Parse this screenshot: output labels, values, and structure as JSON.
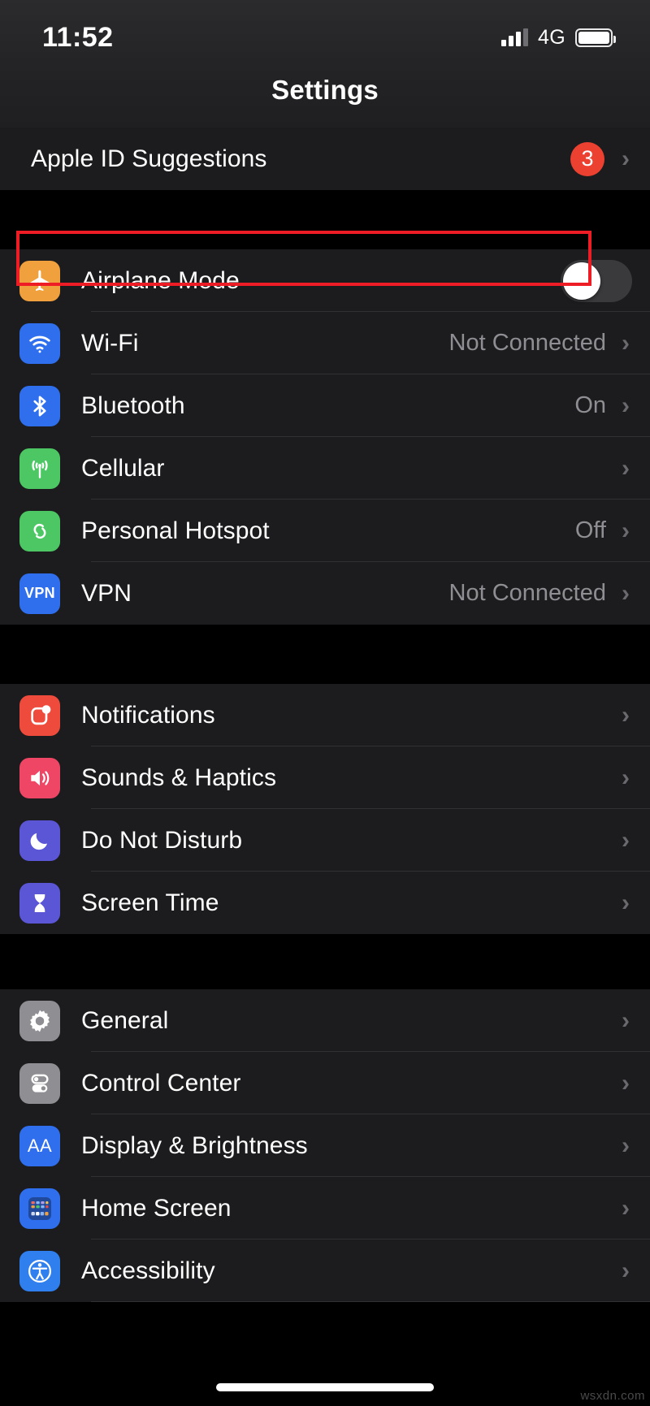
{
  "status_bar": {
    "time": "11:52",
    "network_type": "4G",
    "signal_icon": "signal-bars-icon",
    "battery_icon": "battery-icon"
  },
  "nav": {
    "title": "Settings"
  },
  "sections": [
    {
      "name": "suggestions",
      "rows": [
        {
          "label": "Apple ID Suggestions",
          "badge": "3",
          "chevron": "›",
          "icon": null,
          "type": "plain"
        }
      ]
    },
    {
      "name": "connectivity",
      "rows": [
        {
          "label": "Airplane Mode",
          "icon": "airplane-icon",
          "icon_color": "#F0A03C",
          "type": "toggle",
          "toggle_on": false,
          "highlighted": true
        },
        {
          "label": "Wi-Fi",
          "icon": "wifi-icon",
          "icon_color": "#2F6FED",
          "value": "Not Connected",
          "chevron": "›"
        },
        {
          "label": "Bluetooth",
          "icon": "bluetooth-icon",
          "icon_color": "#2F6FED",
          "value": "On",
          "chevron": "›"
        },
        {
          "label": "Cellular",
          "icon": "cellular-antenna-icon",
          "icon_color": "#4CC764",
          "value": "",
          "chevron": "›"
        },
        {
          "label": "Personal Hotspot",
          "icon": "hotspot-link-icon",
          "icon_color": "#4CC764",
          "value": "Off",
          "chevron": "›"
        },
        {
          "label": "VPN",
          "icon": "vpn-icon",
          "icon_color": "#2F6FED",
          "value": "Not Connected",
          "chevron": "›",
          "icon_text": "VPN"
        }
      ]
    },
    {
      "name": "alerts",
      "rows": [
        {
          "label": "Notifications",
          "icon": "notifications-icon",
          "icon_color": "#EF4B3C",
          "chevron": "›"
        },
        {
          "label": "Sounds & Haptics",
          "icon": "speaker-icon",
          "icon_color": "#EE4664",
          "chevron": "›"
        },
        {
          "label": "Do Not Disturb",
          "icon": "moon-icon",
          "icon_color": "#5A56D6",
          "chevron": "›"
        },
        {
          "label": "Screen Time",
          "icon": "hourglass-icon",
          "icon_color": "#5A56D6",
          "chevron": "›"
        }
      ]
    },
    {
      "name": "system",
      "rows": [
        {
          "label": "General",
          "icon": "gear-icon",
          "icon_color": "#8E8E93",
          "chevron": "›"
        },
        {
          "label": "Control Center",
          "icon": "control-center-icon",
          "icon_color": "#8E8E93",
          "chevron": "›"
        },
        {
          "label": "Display & Brightness",
          "icon": "display-brightness-icon",
          "icon_color": "#2F6FED",
          "icon_text": "AA",
          "chevron": "›"
        },
        {
          "label": "Home Screen",
          "icon": "home-screen-icon",
          "icon_color": "#2F6FED",
          "chevron": "›"
        },
        {
          "label": "Accessibility",
          "icon": "accessibility-icon",
          "icon_color": "#2F7FEF",
          "chevron": "›"
        }
      ]
    }
  ],
  "annotation": {
    "color": "#EE1C25",
    "target": "Airplane Mode"
  },
  "watermark": "wsxdn.com",
  "colors": {
    "row_background": "#1C1C1E",
    "page_background": "#000000",
    "separator": "#313134",
    "secondary_text": "#8E8E93",
    "badge_red": "#EC4130",
    "toggle_track_off": "#3A3A3D"
  }
}
